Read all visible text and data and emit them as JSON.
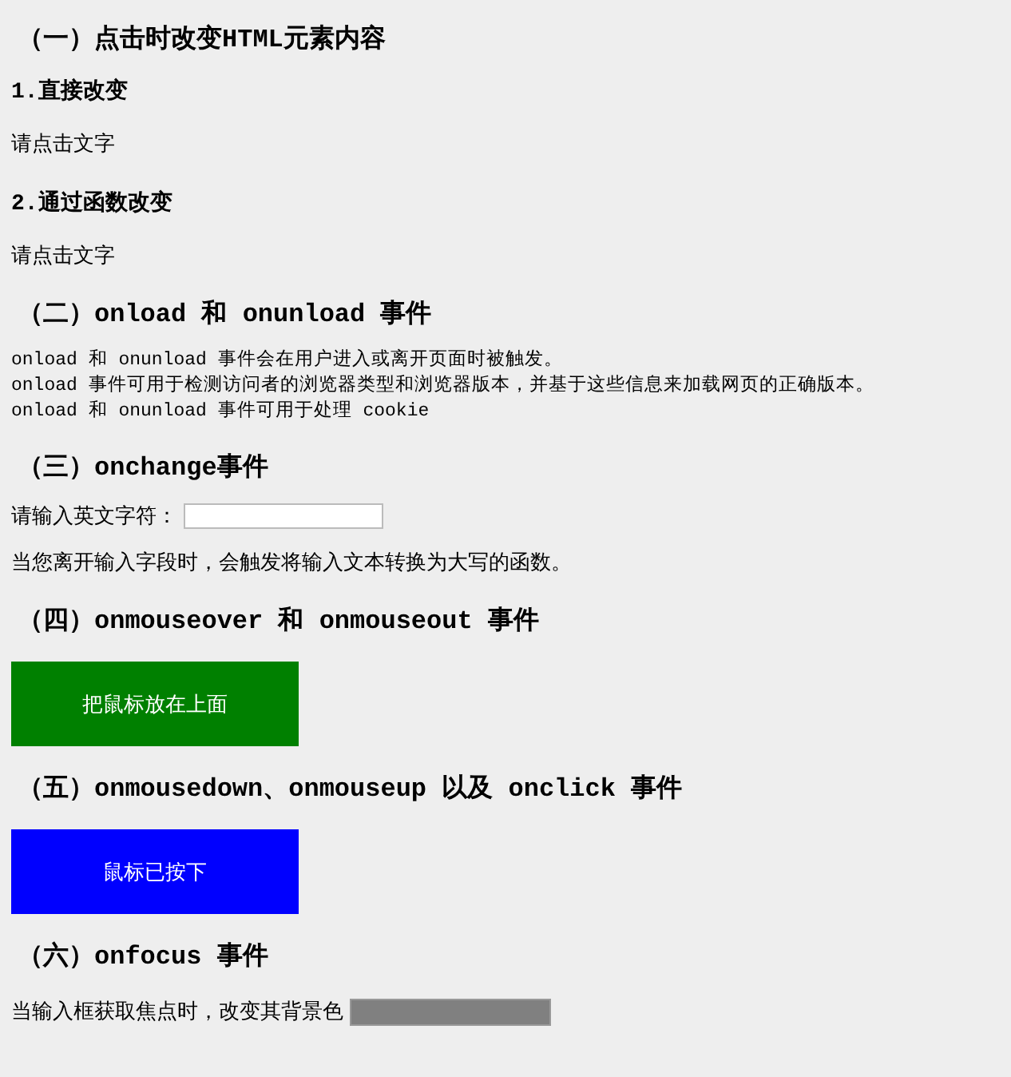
{
  "blocks": [
    {
      "kind": "h2",
      "text": "（一）点击时改变HTML元素内容"
    },
    {
      "kind": "h3",
      "text": "1.直接改变"
    },
    {
      "kind": "p",
      "text": "请点击文字"
    },
    {
      "kind": "h3",
      "text": "2.通过函数改变"
    },
    {
      "kind": "p",
      "text": "请点击文字"
    },
    {
      "kind": "h2",
      "text": "（二）onload 和 onunload 事件"
    },
    {
      "kind": "pre",
      "lines": [
        "onload 和 onunload 事件会在用户进入或离开页面时被触发。",
        "onload 事件可用于检测访问者的浏览器类型和浏览器版本，并基于这些信息来加载网页的正确版本。",
        "onload 和 onunload 事件可用于处理 cookie"
      ]
    },
    {
      "kind": "h2",
      "text": "（三）onchange事件"
    },
    {
      "kind": "field",
      "label": "请输入英文字符："
    },
    {
      "kind": "p",
      "text": "当您离开输入字段时，会触发将输入文本转换为大写的函数。"
    },
    {
      "kind": "h2",
      "text": "（四）onmouseover 和 onmouseout 事件"
    },
    {
      "kind": "box",
      "text": "把鼠标放在上面",
      "color": "#008000"
    },
    {
      "kind": "h2",
      "text": "（五）onmousedown、onmouseup 以及 onclick 事件"
    },
    {
      "kind": "box",
      "text": "鼠标已按下",
      "color": "#0000ff"
    },
    {
      "kind": "h2",
      "text": "（六）onfocus 事件"
    },
    {
      "kind": "focusfield",
      "label": "当输入框获取焦点时，改变其背景色"
    }
  ]
}
